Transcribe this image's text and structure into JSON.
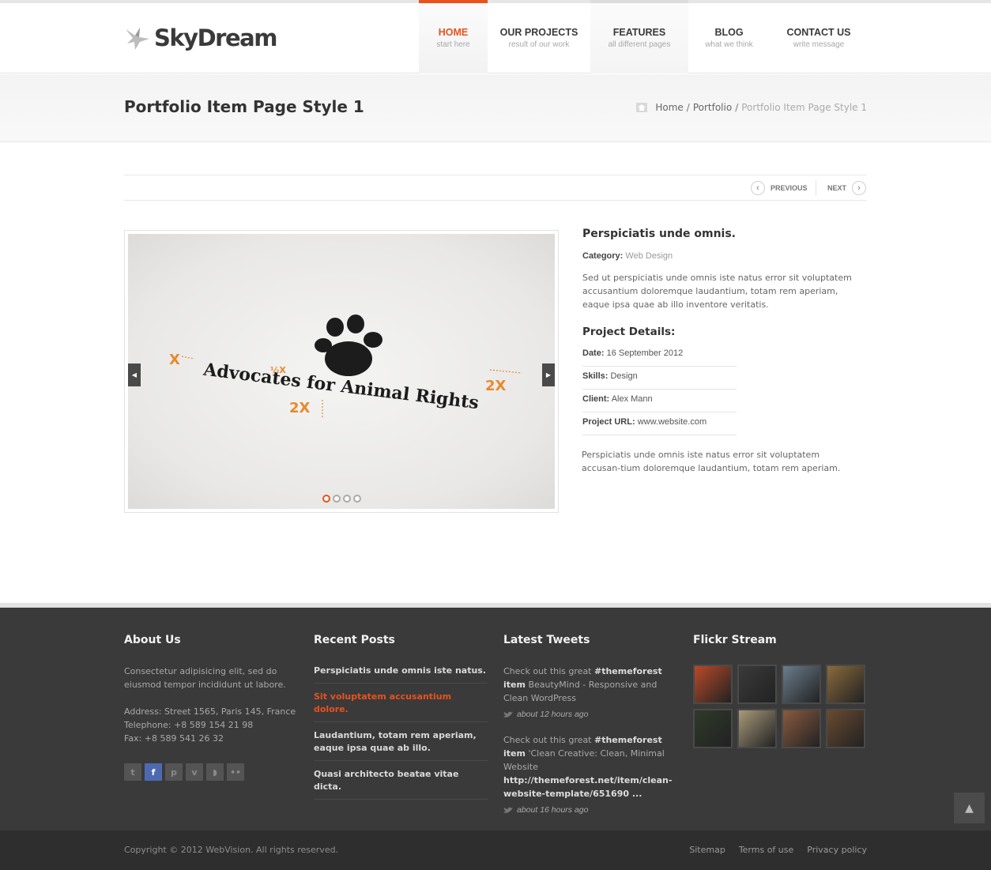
{
  "header": {
    "brand": "SkyDream",
    "nav": [
      {
        "label": "HOME",
        "sub": "start here"
      },
      {
        "label": "OUR PROJECTS",
        "sub": "result of our work"
      },
      {
        "label": "FEATURES",
        "sub": "all different pages"
      },
      {
        "label": "BLOG",
        "sub": "what we think"
      },
      {
        "label": "CONTACT US",
        "sub": "write message"
      }
    ],
    "active_color": "#e8521c"
  },
  "titlebar": {
    "title": "Portfolio Item Page Style 1",
    "breadcrumb": {
      "home": "Home",
      "sep": "/",
      "portfolio": "Portfolio",
      "current": "Portfolio Item Page Style 1"
    }
  },
  "pager": {
    "previous": "PREVIOUS",
    "next": "NEXT"
  },
  "slider": {
    "logo_text": "Advocates for Animal Rights",
    "marks": [
      "X",
      "½X",
      "2X",
      "2X"
    ],
    "slide_count": 4,
    "active_slide": 1
  },
  "project": {
    "title": "Perspiciatis unde omnis.",
    "category_label": "Category:",
    "category": "Web Design",
    "description": "Sed ut perspiciatis unde omnis iste natus error sit voluptatem accusantium doloremque laudantium, totam rem aperiam, eaque ipsa quae ab illo inventore veritatis.",
    "details_title": "Project Details:",
    "details": [
      {
        "label": "Date:",
        "value": "16 September 2012"
      },
      {
        "label": "Skills:",
        "value": "Design"
      },
      {
        "label": "Client:",
        "value": " Alex Mann"
      },
      {
        "label": "Project URL:",
        "value": " www.website.com"
      }
    ],
    "description2": "Perspiciatis unde omnis iste natus error sit voluptatem accusan-tium doloremque laudantium, totam rem aperiam."
  },
  "footer": {
    "about": {
      "title": "About Us",
      "text": "Consectetur adipisicing elit, sed do eiusmod tempor incididunt ut labore.",
      "address": "Address: Street 1565, Paris 145, France",
      "telephone": "Telephone: +8 589 154 21 98",
      "fax": "Fax: +8 589 541 26 32",
      "social": [
        "twitter-icon",
        "facebook-icon",
        "pinterest-icon",
        "vimeo-icon",
        "rss-icon",
        "flickr-icon"
      ]
    },
    "posts": {
      "title": "Recent Posts",
      "items": [
        "Perspiciatis unde omnis iste natus.",
        "Sit voluptatem accusantium dolore.",
        "Laudantium, totam rem aperiam, eaque ipsa quae ab illo.",
        "Quasi architecto beatae vitae dicta."
      ]
    },
    "tweets": {
      "title": "Latest Tweets",
      "items": [
        {
          "pre": "Check out this great ",
          "tag": "#themeforest item",
          "text": " BeautyMind - Responsive and Clean WordPress",
          "link": "",
          "time": "about 12 hours ago"
        },
        {
          "pre": "Check out this great ",
          "tag": "#themeforest item",
          "text": " 'Clean Creative: Clean, Minimal Website ",
          "link": "http://themeforest.net/item/clean-website-template/651690 ...",
          "time": "about 16 hours ago"
        }
      ]
    },
    "flickr": {
      "title": "Flickr Stream",
      "thumb_colors": [
        "#b84a28",
        "#3a3a3a",
        "#6a7d8c",
        "#8a6a3c",
        "#2f3a2a",
        "#a89a7a",
        "#8a5a40",
        "#6a4a30"
      ]
    }
  },
  "bottom": {
    "copyright": "Copyright © 2012 WebVision. All rights reserved.",
    "links": [
      "Sitemap",
      "Terms of use",
      "Privacy policy"
    ]
  }
}
